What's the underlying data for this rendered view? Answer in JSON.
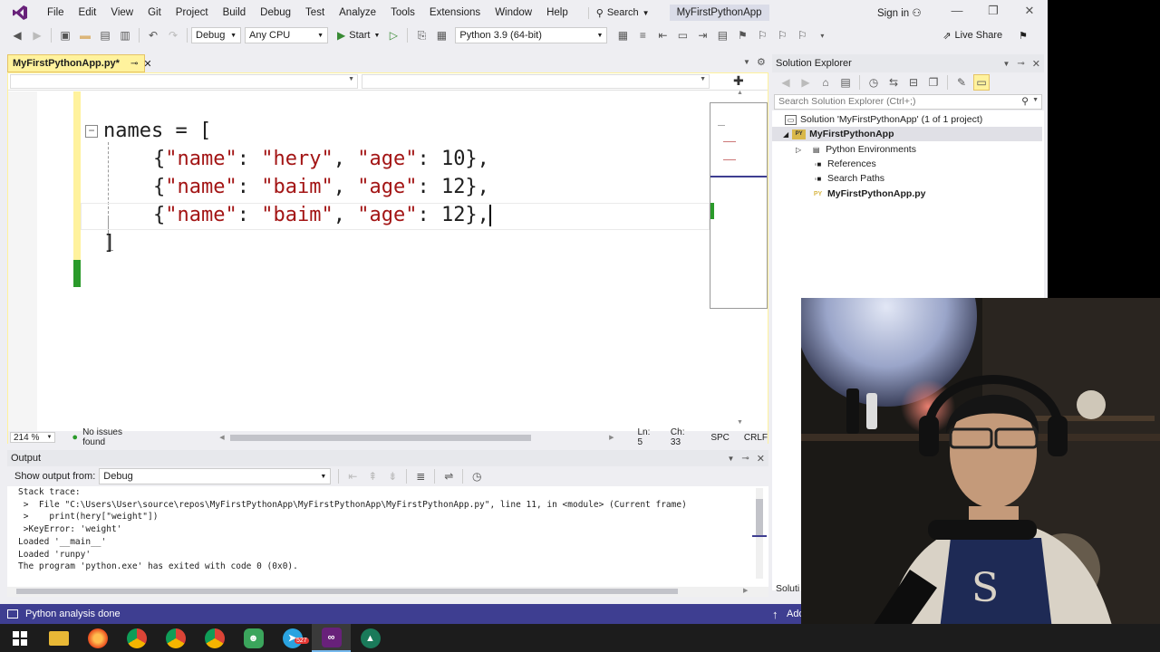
{
  "app": {
    "menu": [
      "File",
      "Edit",
      "View",
      "Git",
      "Project",
      "Build",
      "Debug",
      "Test",
      "Analyze",
      "Tools",
      "Extensions",
      "Window",
      "Help"
    ],
    "search_label": "Search",
    "title": "MyFirstPythonApp",
    "signin": "Sign in",
    "live_share": "Live Share"
  },
  "toolbar": {
    "config": "Debug",
    "platform": "Any CPU",
    "start_label": "Start",
    "python_env": "Python 3.9 (64-bit)"
  },
  "editor": {
    "tab_name": "MyFirstPythonApp.py*",
    "zoom": "214 %",
    "issues": "No issues found",
    "ln": "Ln: 5",
    "ch": "Ch: 33",
    "spc": "SPC",
    "crlf": "CRLF",
    "code": {
      "l1_var": "names = [",
      "l2_open": "{",
      "l2_k1": "\"name\"",
      "l2_c1": ": ",
      "l2_v1": "\"hery\"",
      "l2_sep": ", ",
      "l2_k2": "\"age\"",
      "l2_rest": ": 10},",
      "l3_open": "{",
      "l3_k1": "\"name\"",
      "l3_c1": ": ",
      "l3_v1": "\"baim\"",
      "l3_sep": ", ",
      "l3_k2": "\"age\"",
      "l3_rest": ": 12},",
      "l4_open": "{",
      "l4_k1": "\"name\"",
      "l4_c1": ": ",
      "l4_v1": "\"baim\"",
      "l4_sep": ", ",
      "l4_k2": "\"age\"",
      "l4_rest": ": 12},",
      "l5": "]"
    }
  },
  "output": {
    "title": "Output",
    "show_from_label": "Show output from:",
    "source": "Debug",
    "lines": [
      "Stack trace:",
      " >  File \"C:\\Users\\User\\source\\repos\\MyFirstPythonApp\\MyFirstPythonApp\\MyFirstPythonApp.py\", line 11, in <module> (Current frame)",
      " >    print(hery[\"weight\"])",
      " >KeyError: 'weight'",
      "Loaded '__main__'",
      "Loaded 'runpy'",
      "The program 'python.exe' has exited with code 0 (0x0)."
    ]
  },
  "solution_explorer": {
    "title": "Solution Explorer",
    "search_placeholder": "Search Solution Explorer (Ctrl+;)",
    "solution": "Solution 'MyFirstPythonApp' (1 of 1 project)",
    "project": "MyFirstPythonApp",
    "items": [
      "Python Environments",
      "References",
      "Search Paths"
    ],
    "file": "MyFirstPythonApp.py",
    "bottom_tab": "Soluti",
    "py_badge": "PY"
  },
  "statusbar": {
    "text": "Python analysis done",
    "right": "Add"
  },
  "taskbar": {
    "apps": [
      "windows",
      "explorer",
      "firefox",
      "chrome",
      "chrome",
      "chrome",
      "discord",
      "telegram",
      "visual-studio",
      "vscode"
    ],
    "telegram_badge": "527"
  },
  "colors": {
    "accent": "#68217a",
    "statusbar": "#3e3e91",
    "tab_active": "#fff29d",
    "string": "#a31515"
  }
}
